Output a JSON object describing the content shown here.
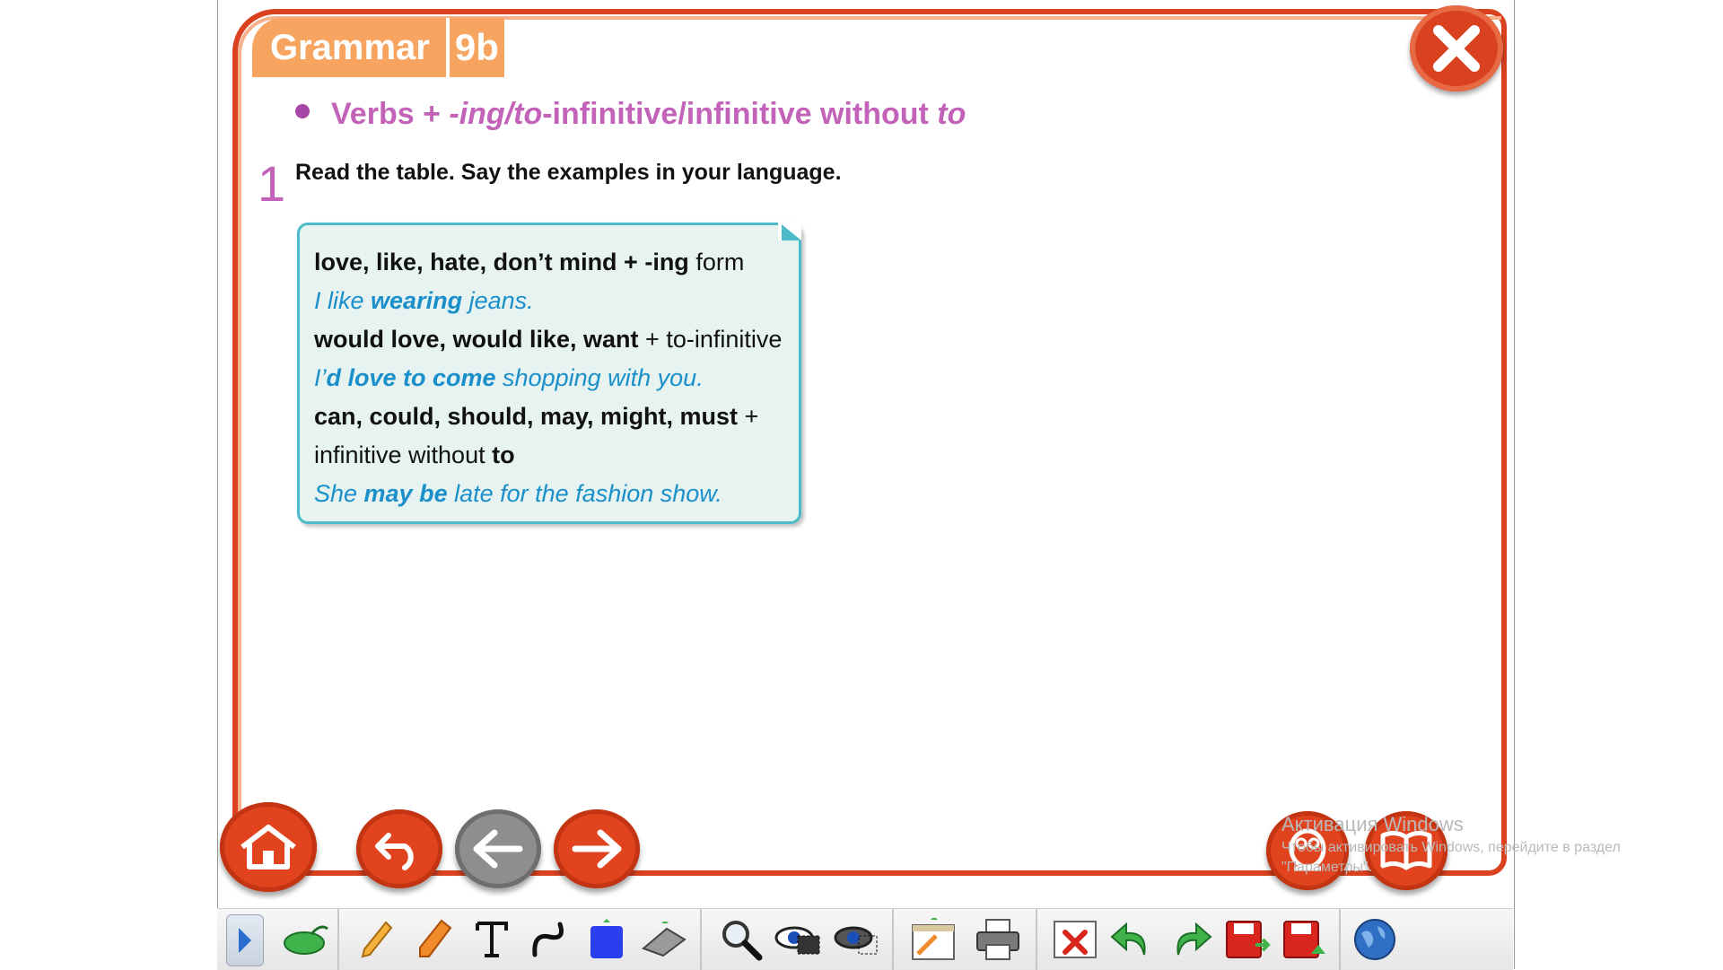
{
  "page": {
    "title_label": "Grammar",
    "title_number": "9b",
    "heading_part1": "Verbs + ",
    "heading_part2": "-ing/to",
    "heading_part3": "-infinitive/infinitive without ",
    "heading_part4": "to",
    "exercise_number": "1",
    "instruction": "Read the table. Say the examples in your language."
  },
  "grammar_box": {
    "l1_bold": "love, like, hate, don’t mind + -ing",
    "l1_rest": " form",
    "l2_pre": "I like ",
    "l2_bold": "wearing",
    "l2_post": " jeans.",
    "l3_bold": "would love, would like, want",
    "l3_rest": " + to-infinitive",
    "l4_pre": "I’",
    "l4_bold": "d love to come",
    "l4_post": " shopping with you.",
    "l5_bold": "can, could, should, may, might, must",
    "l5_rest": " +",
    "l6_rest": "infinitive without ",
    "l6_bold": "to",
    "l7_pre": "She ",
    "l7_bold": "may be",
    "l7_post": " late for the fashion show."
  },
  "watermark": {
    "line1": "Активация Windows",
    "line2": "Чтобы активировать Windows, перейдите в раздел",
    "line3": "\"Параметры\"."
  },
  "colors": {
    "frame_red": "#d9411f",
    "tab_orange": "#f7a460",
    "heading_purple": "#c262b8",
    "example_blue": "#1a8fc9",
    "box_border": "#4dbac9",
    "box_fill": "#e6f3f1"
  },
  "icons": {
    "close": "close-icon",
    "home": "home-icon",
    "undo": "undo-arrow-icon",
    "back": "left-arrow-icon",
    "forward": "right-arrow-icon",
    "owl": "owl-icon",
    "book": "book-icon"
  }
}
